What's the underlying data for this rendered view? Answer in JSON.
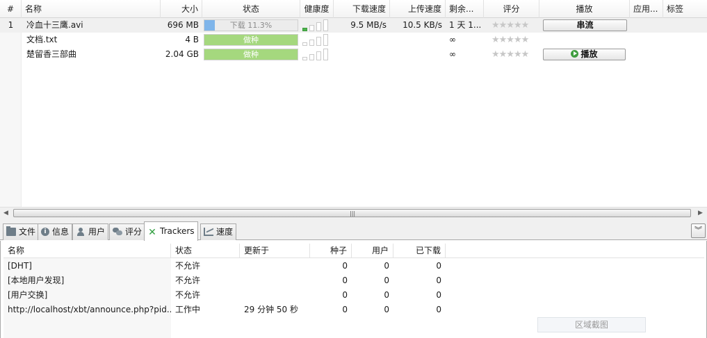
{
  "columns": {
    "num": "#",
    "name": "名称",
    "size": "大小",
    "status": "状态",
    "health": "健康度",
    "down_speed": "下载速度",
    "up_speed": "上传速度",
    "remaining": "剩余...",
    "rating": "评分",
    "play": "播放",
    "app": "应用...",
    "tags": "标签"
  },
  "torrents": [
    {
      "num": "1",
      "name": "冷血十三鹰.avi",
      "size": "696 MB",
      "status": "下载 11.3%",
      "progress": 0.113,
      "mode": "downloading",
      "health_bars_on": 1,
      "down_speed": "9.5 MB/s",
      "up_speed": "10.5 KB/s",
      "remaining": "1 天 1...",
      "stars": "★★★★★",
      "play_label": "串流"
    },
    {
      "num": "",
      "name": "文档.txt",
      "size": "4 B",
      "status": "做种",
      "progress": 1.0,
      "mode": "seeding",
      "health_bars_on": 0,
      "down_speed": "",
      "up_speed": "",
      "remaining": "∞",
      "stars": "★★★★★",
      "play_label": ""
    },
    {
      "num": "",
      "name": "楚留香三部曲",
      "size": "2.04 GB",
      "status": "做种",
      "progress": 1.0,
      "mode": "seeding",
      "health_bars_on": 0,
      "down_speed": "",
      "up_speed": "",
      "remaining": "∞",
      "stars": "★★★★★",
      "play_label": "播放"
    }
  ],
  "scrollbar": {
    "grip": "|||"
  },
  "tabs": [
    {
      "label": "文件",
      "icon": "folder-icon"
    },
    {
      "label": "信息",
      "icon": "info-icon"
    },
    {
      "label": "用户",
      "icon": "user-icon"
    },
    {
      "label": "评分",
      "icon": "rating-icon"
    },
    {
      "label": "Trackers",
      "icon": "trackers-icon",
      "active": true
    },
    {
      "label": "速度",
      "icon": "speed-icon"
    }
  ],
  "tracker_columns": {
    "name": "名称",
    "status": "状态",
    "updated": "更新于",
    "seeds": "种子",
    "peers": "用户",
    "downloaded": "已下载"
  },
  "trackers": [
    {
      "name": "[DHT]",
      "status": "不允许",
      "updated": "",
      "seeds": "0",
      "peers": "0",
      "downloaded": "0"
    },
    {
      "name": "[本地用户发现]",
      "status": "不允许",
      "updated": "",
      "seeds": "0",
      "peers": "0",
      "downloaded": "0"
    },
    {
      "name": "[用户交换]",
      "status": "不允许",
      "updated": "",
      "seeds": "0",
      "peers": "0",
      "downloaded": "0"
    },
    {
      "name": "http://localhost/xbt/announce.php?pid...",
      "status": "工作中",
      "updated": "29 分钟 50 秒",
      "seeds": "0",
      "peers": "0",
      "downloaded": "0"
    }
  ],
  "capture_button": "区域截图",
  "colors": {
    "download_bar": "#7fb5ea",
    "seed_bar": "#a5d87e",
    "health_on": "#4cb34c",
    "tracker_icon": "#2e9e3e"
  }
}
